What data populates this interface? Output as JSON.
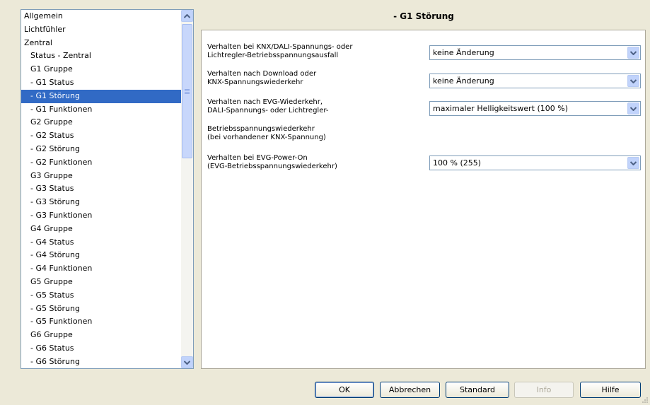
{
  "tree": {
    "items": [
      {
        "label": "Allgemein",
        "level": 0,
        "selected": false
      },
      {
        "label": "Lichtfühler",
        "level": 0,
        "selected": false
      },
      {
        "label": "Zentral",
        "level": 0,
        "selected": false
      },
      {
        "label": "Status - Zentral",
        "level": 1,
        "selected": false
      },
      {
        "label": "G1 Gruppe",
        "level": 1,
        "selected": false
      },
      {
        "label": "- G1 Status",
        "level": 1,
        "selected": false
      },
      {
        "label": "- G1 Störung",
        "level": 1,
        "selected": true
      },
      {
        "label": "- G1 Funktionen",
        "level": 1,
        "selected": false
      },
      {
        "label": "G2 Gruppe",
        "level": 1,
        "selected": false
      },
      {
        "label": "- G2 Status",
        "level": 1,
        "selected": false
      },
      {
        "label": "- G2 Störung",
        "level": 1,
        "selected": false
      },
      {
        "label": "- G2 Funktionen",
        "level": 1,
        "selected": false
      },
      {
        "label": "G3 Gruppe",
        "level": 1,
        "selected": false
      },
      {
        "label": "- G3 Status",
        "level": 1,
        "selected": false
      },
      {
        "label": "- G3 Störung",
        "level": 1,
        "selected": false
      },
      {
        "label": "- G3 Funktionen",
        "level": 1,
        "selected": false
      },
      {
        "label": "G4 Gruppe",
        "level": 1,
        "selected": false
      },
      {
        "label": "- G4 Status",
        "level": 1,
        "selected": false
      },
      {
        "label": "- G4 Störung",
        "level": 1,
        "selected": false
      },
      {
        "label": "- G4 Funktionen",
        "level": 1,
        "selected": false
      },
      {
        "label": "G5 Gruppe",
        "level": 1,
        "selected": false
      },
      {
        "label": "- G5 Status",
        "level": 1,
        "selected": false
      },
      {
        "label": "- G5 Störung",
        "level": 1,
        "selected": false
      },
      {
        "label": "- G5 Funktionen",
        "level": 1,
        "selected": false
      },
      {
        "label": "G6 Gruppe",
        "level": 1,
        "selected": false
      },
      {
        "label": "- G6 Status",
        "level": 1,
        "selected": false
      },
      {
        "label": "- G6 Störung",
        "level": 1,
        "selected": false
      }
    ]
  },
  "page": {
    "title": "- G1 Störung"
  },
  "params": {
    "p1": {
      "label_line1": "Verhalten bei KNX/DALI-Spannungs- oder",
      "label_line2": "Lichtregler-Betriebsspannungsausfall",
      "value": "keine Änderung"
    },
    "p2": {
      "label_line1": "Verhalten nach Download oder",
      "label_line2": "KNX-Spannungswiederkehr",
      "value": "keine Änderung"
    },
    "p3": {
      "label_line1": "Verhalten nach EVG-Wiederkehr,",
      "label_line2": "DALI-Spannungs- oder Lichtregler-",
      "label_line3": "Betriebsspannungswiederkehr",
      "label_line4": "(bei vorhandener KNX-Spannung)",
      "value": "maximaler Helligkeitswert (100 %)"
    },
    "p4": {
      "label_line1": "Verhalten bei EVG-Power-On",
      "label_line2": "(EVG-Betriebsspannungswiederkehr)",
      "value": "100 % (255)"
    }
  },
  "buttons": {
    "ok": "OK",
    "cancel": "Abbrechen",
    "standard": "Standard",
    "info": "Info",
    "help": "Hilfe"
  },
  "icons": {
    "dropdown": "chevron-down-icon",
    "scroll_up": "chevron-up-icon",
    "scroll_down": "chevron-down-icon"
  },
  "colors": {
    "selection": "#316ac5",
    "window_bg": "#ece9d8"
  }
}
